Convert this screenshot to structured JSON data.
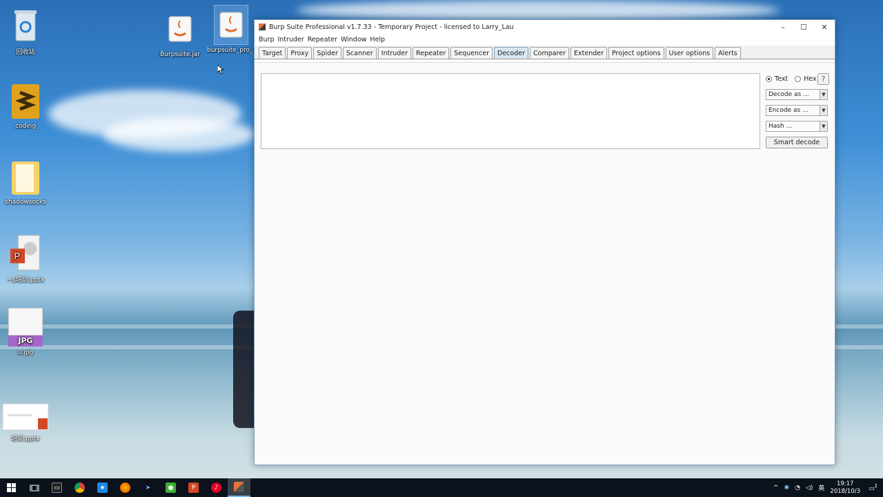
{
  "desktop": {
    "icons": [
      {
        "label": "回收站"
      },
      {
        "label": "coding"
      },
      {
        "label": "shadowsocks"
      },
      {
        "label": "~$培训.pptx"
      },
      {
        "label": "0.jpg"
      },
      {
        "label": "培训.pptx"
      },
      {
        "label": "Burpsuite.jar"
      },
      {
        "label": "burpsuite_pro_1..."
      }
    ],
    "jpg_badge": "JPG"
  },
  "window": {
    "title": "Burp Suite Professional v1.7.33 - Temporary Project - licensed to Larry_Lau",
    "controls": {
      "minimize": "–",
      "maximize": "☐",
      "close": "✕"
    },
    "menu": [
      "Burp",
      "Intruder",
      "Repeater",
      "Window",
      "Help"
    ],
    "tabs": [
      "Target",
      "Proxy",
      "Spider",
      "Scanner",
      "Intruder",
      "Repeater",
      "Sequencer",
      "Decoder",
      "Comparer",
      "Extender",
      "Project options",
      "User options",
      "Alerts"
    ],
    "active_tab": "Decoder"
  },
  "decoder": {
    "input_value": "",
    "radio_text": "Text",
    "radio_hex": "Hex",
    "selected_mode": "Text",
    "help": "?",
    "decode_as": "Decode as ...",
    "encode_as": "Encode as ...",
    "hash": "Hash ...",
    "smart_decode": "Smart decode"
  },
  "taskbar": {
    "tray_lang": "英",
    "time": "19:17",
    "date": "2018/10/3",
    "notification_count": "2"
  }
}
